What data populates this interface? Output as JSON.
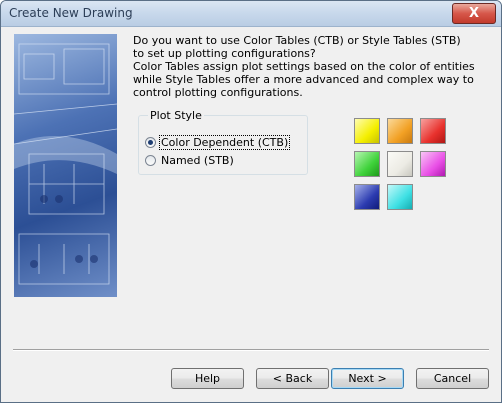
{
  "window": {
    "title": "Create New Drawing",
    "close_symbol": "X"
  },
  "intro": {
    "lines": [
      "Do you want to use Color Tables (CTB) or Style Tables (STB)",
      "to set up plotting configurations?",
      "Color Tables assign plot settings based on the color of entities",
      "while Style Tables offer a more advanced and complex way to",
      "control plotting configurations."
    ]
  },
  "plot_style": {
    "group_label": "Plot Style",
    "options": [
      {
        "label": "Color Dependent (CTB)",
        "selected": true
      },
      {
        "label": "Named (STB)",
        "selected": false
      }
    ]
  },
  "color_swatches": [
    {
      "name": "yellow",
      "color": "#f4ef00"
    },
    {
      "name": "orange",
      "color": "#f2a124"
    },
    {
      "name": "red",
      "color": "#e8312d"
    },
    {
      "name": "green",
      "color": "#3fd23a"
    },
    {
      "name": "white",
      "color": "#ecebe4"
    },
    {
      "name": "magenta",
      "color": "#e94fe6"
    },
    {
      "name": "blue",
      "color": "#2c3cb0"
    },
    {
      "name": "cyan",
      "color": "#3fe0e4"
    }
  ],
  "buttons": {
    "help": "Help",
    "back": "< Back",
    "next": "Next >",
    "cancel": "Cancel"
  }
}
